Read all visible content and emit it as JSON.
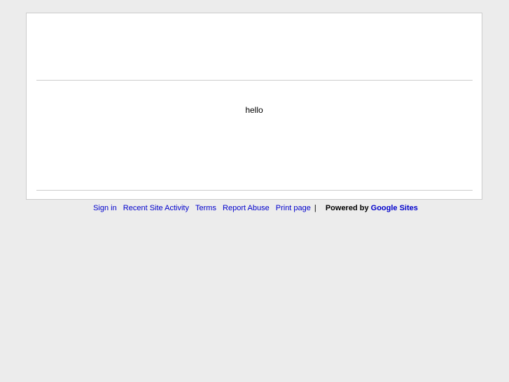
{
  "content": {
    "body_text": "hello"
  },
  "footer": {
    "links": {
      "sign_in": "Sign in",
      "recent_activity": "Recent Site Activity",
      "terms": "Terms",
      "report_abuse": "Report Abuse",
      "print_page": "Print page"
    },
    "separator": "|",
    "powered_by": "Powered by",
    "google_sites": "Google Sites"
  }
}
